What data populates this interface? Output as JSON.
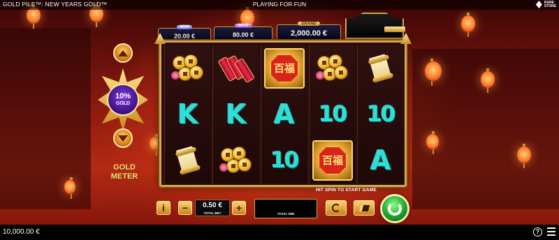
{
  "header": {
    "game_title": "GOLD PILE™: NEW YEARS GOLD™",
    "mode_label": "PLAYING FOR FUN",
    "brand": "RARE\nSTONE"
  },
  "jackpots": [
    {
      "name": "MINI",
      "value": "20.00 €"
    },
    {
      "name": "MAXI",
      "value": "80.00 €"
    },
    {
      "name": "GRAND",
      "value": "2,000.00 €"
    }
  ],
  "gold_meter": {
    "percent": "10%",
    "word": "GOLD",
    "title": "GOLD\nMETER",
    "percent_value": 10
  },
  "reels": [
    [
      "coins",
      "K",
      "scroll"
    ],
    [
      "firecracker",
      "K",
      "coins"
    ],
    [
      "gold-bonus",
      "A",
      "10"
    ],
    [
      "coins",
      "10",
      "gold-bonus"
    ],
    [
      "scroll",
      "10",
      "A"
    ]
  ],
  "gold_bonus_glyph": "百福",
  "hint": "HIT SPIN TO START GAME",
  "controls": {
    "info_label": "i",
    "minus_label": "−",
    "plus_label": "+",
    "bet_value": "0.50 €",
    "bet_label": "TOTAL BET",
    "win_label": "TOTAL WIN",
    "win_value": ""
  },
  "footer": {
    "balance": "10,000.00 €",
    "help_label": "?"
  },
  "colors": {
    "gold": "#d9a64e",
    "teal_symbol": "#2de0d6",
    "spin_green": "#19a52a",
    "meter_purple": "#3a0c80"
  }
}
